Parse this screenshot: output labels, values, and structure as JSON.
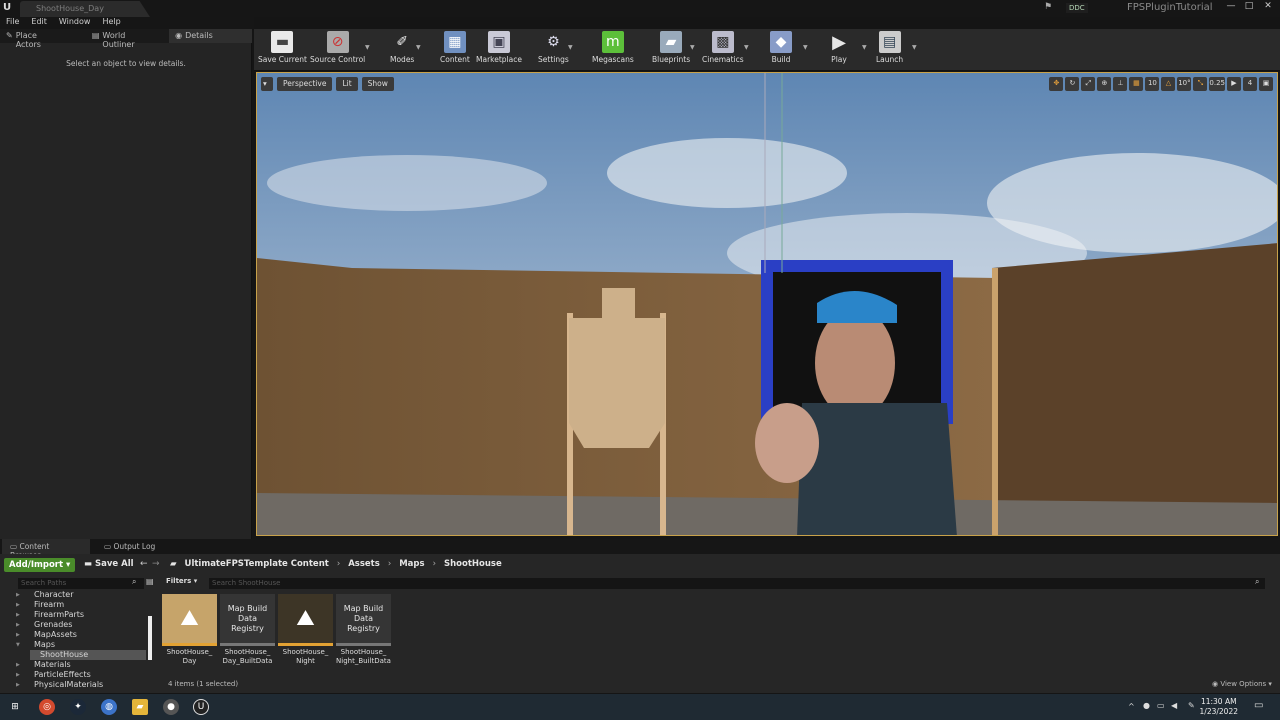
{
  "window": {
    "doc_tab": "ShootHouse_Day",
    "project": "FPSPluginTutorial",
    "ddc": "DDC",
    "logo": "U"
  },
  "menu": [
    "File",
    "Edit",
    "Window",
    "Help"
  ],
  "left_panel": {
    "tabs": [
      "Place Actors",
      "World Outliner",
      "Details"
    ],
    "empty_text": "Select an object to view details."
  },
  "toolbar": [
    {
      "label": "Save Current",
      "icon": "save-icon"
    },
    {
      "label": "Source Control",
      "icon": "source-control-icon"
    },
    {
      "label": "Modes",
      "icon": "modes-icon"
    },
    {
      "label": "Content",
      "icon": "content-icon"
    },
    {
      "label": "Marketplace",
      "icon": "marketplace-icon"
    },
    {
      "label": "Settings",
      "icon": "settings-icon"
    },
    {
      "label": "Megascans",
      "icon": "megascans-icon"
    },
    {
      "label": "Blueprints",
      "icon": "blueprints-icon"
    },
    {
      "label": "Cinematics",
      "icon": "cinematics-icon"
    },
    {
      "label": "Build",
      "icon": "build-icon"
    },
    {
      "label": "Play",
      "icon": "play-icon"
    },
    {
      "label": "Launch",
      "icon": "launch-icon"
    }
  ],
  "viewport": {
    "perspective": "Perspective",
    "lit": "Lit",
    "show": "Show",
    "grid_snap": "10",
    "rot_snap": "10°",
    "scale_snap": "0.25",
    "camera_speed": "4"
  },
  "bottom_tabs": [
    "Content Browser",
    "Output Log"
  ],
  "content_browser": {
    "add_import": "Add/Import",
    "save_all": "Save All",
    "breadcrumb": [
      "UltimateFPSTemplate Content",
      "Assets",
      "Maps",
      "ShootHouse"
    ],
    "search_paths_placeholder": "Search Paths",
    "filters": "Filters",
    "search_placeholder": "Search ShootHouse",
    "tree": [
      "Character",
      "Firearm",
      "FirearmParts",
      "Grenades",
      "MapAssets",
      "Maps",
      "ShootHouse",
      "Materials",
      "ParticleEffects",
      "PhysicalMaterials"
    ],
    "assets": [
      {
        "label": "ShootHouse_\nDay",
        "thumb": "",
        "kind": "map",
        "selected": true
      },
      {
        "label": "ShootHouse_\nDay_BuiltData",
        "thumb": "Map Build\nData\nRegistry",
        "kind": "reg",
        "selected": false
      },
      {
        "label": "ShootHouse_\nNight",
        "thumb": "",
        "kind": "map",
        "selected": false
      },
      {
        "label": "ShootHouse_\nNight_BuiltData",
        "thumb": "Map Build\nData\nRegistry",
        "kind": "reg",
        "selected": false
      }
    ],
    "item_count": "4 items (1 selected)",
    "view_options": "View Options"
  },
  "taskbar": {
    "time": "11:30 AM",
    "date": "1/23/2022"
  }
}
